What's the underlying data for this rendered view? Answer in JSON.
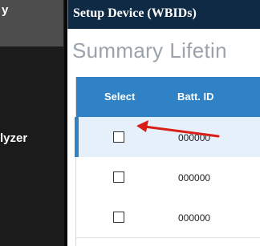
{
  "sidebar": {
    "items": [
      {
        "label": "y"
      },
      {
        "label": "lyzer"
      }
    ]
  },
  "window": {
    "title": "Setup Device  (WBIDs)"
  },
  "tabs": [
    {
      "label": "Summary"
    },
    {
      "label": "Lifetin"
    }
  ],
  "table": {
    "columns": [
      "Select",
      "Batt. ID"
    ],
    "rows": [
      {
        "checked": false,
        "batt_id": "000000",
        "selected": true
      },
      {
        "checked": false,
        "batt_id": "000000",
        "selected": false
      },
      {
        "checked": false,
        "batt_id": "000000",
        "selected": false
      }
    ]
  },
  "annotation": {
    "arrow_color": "#d91e18"
  },
  "colors": {
    "title_bar": "#0f2a44",
    "table_header": "#2f82c6",
    "sidebar": "#1b1b1b"
  }
}
